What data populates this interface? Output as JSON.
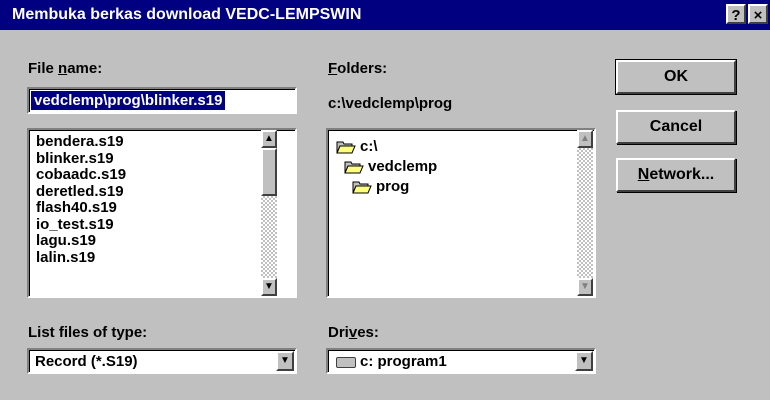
{
  "window": {
    "title": "Membuka berkas download VEDC-LEMPSWIN",
    "help_label": "?",
    "close_label": "×"
  },
  "file_name": {
    "label_pre": "File ",
    "label_u": "n",
    "label_post": "ame:",
    "value": "vedclemp\\prog\\blinker.s19"
  },
  "files": {
    "items": [
      "bendera.s19",
      "blinker.s19",
      "cobaadc.s19",
      "deretled.s19",
      "flash40.s19",
      "io_test.s19",
      "lagu.s19",
      "lalin.s19"
    ]
  },
  "folders": {
    "label_u": "F",
    "label_post": "olders:",
    "current_path": "c:\\vedclemp\\prog",
    "tree": [
      {
        "name": "c:\\",
        "open": true
      },
      {
        "name": "vedclemp",
        "open": true
      },
      {
        "name": "prog",
        "open": true
      }
    ]
  },
  "file_type": {
    "label": "List files of type:",
    "selected": "Record (*.S19)"
  },
  "drives": {
    "label_pre": "Dri",
    "label_u": "v",
    "label_post": "es:",
    "selected": "c: program1"
  },
  "buttons": {
    "ok": "OK",
    "cancel": "Cancel",
    "network_u": "N",
    "network_rest": "etwork..."
  },
  "colors": {
    "titlebar": "#000080",
    "face": "#c0c0c0",
    "selection": "#000080",
    "folder": "#ffff80"
  }
}
